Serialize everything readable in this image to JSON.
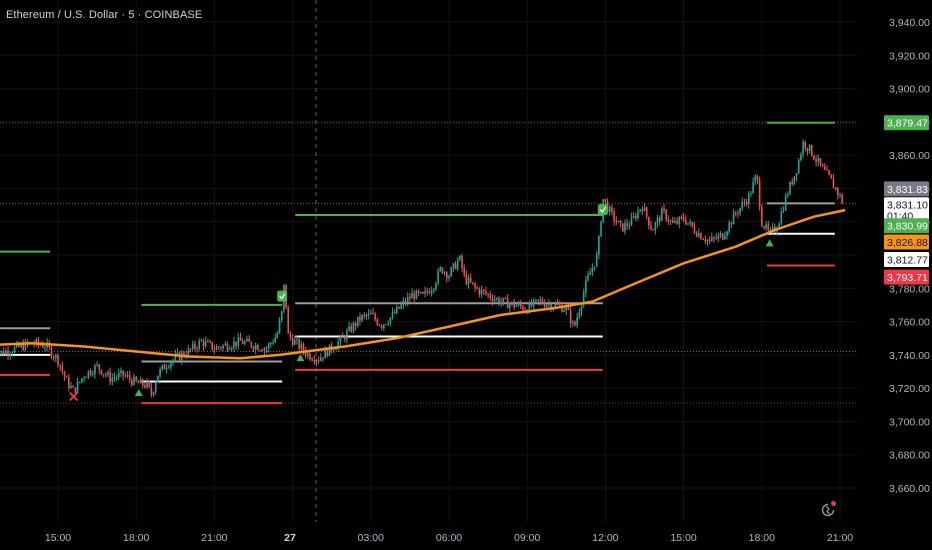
{
  "chart_title": "Ethereum / U.S. Dollar · 5 · COINBASE",
  "colors": {
    "background": "#000000",
    "up": "#26a69a",
    "down": "#ef5350",
    "ema": "#f7931a",
    "green_level": "#4caf50",
    "red_level": "#f23645",
    "white_level": "#ffffff",
    "gray_level": "#9e9e9e",
    "axis_text": "#b2b5be"
  },
  "chart_data": {
    "type": "candlestick",
    "symbol": "ETHUSD",
    "interval": "5",
    "exchange": "COINBASE",
    "y_range": [
      3650,
      3950
    ],
    "y_ticks": [
      "3,940.00",
      "3,920.00",
      "3,900.00",
      "3,880.00",
      "3,860.00",
      "3,840.00",
      "3,820.00",
      "3,800.00",
      "3,780.00",
      "3,760.00",
      "3,740.00",
      "3,720.00",
      "3,700.00",
      "3,680.00",
      "3,660.00"
    ],
    "y_tick_values": [
      3940,
      3920,
      3900,
      3880,
      3860,
      3840,
      3820,
      3800,
      3780,
      3760,
      3740,
      3720,
      3700,
      3680,
      3660
    ],
    "x_range": [
      12.5,
      45.5
    ],
    "x_ticks": [
      {
        "label": "15:00",
        "hour": 15
      },
      {
        "label": "18:00",
        "hour": 18
      },
      {
        "label": "21:00",
        "hour": 21
      },
      {
        "label": "27",
        "hour": 24,
        "bold": true
      },
      {
        "label": "03:00",
        "hour": 27
      },
      {
        "label": "06:00",
        "hour": 30
      },
      {
        "label": "09:00",
        "hour": 33
      },
      {
        "label": "12:00",
        "hour": 36
      },
      {
        "label": "15:00",
        "hour": 39
      },
      {
        "label": "18:00",
        "hour": 42
      },
      {
        "label": "21:00",
        "hour": 45
      }
    ],
    "session_separator_hour": 24,
    "price_path": [
      [
        12.5,
        3740
      ],
      [
        13.2,
        3743
      ],
      [
        14.0,
        3747
      ],
      [
        14.5,
        3746
      ],
      [
        15.0,
        3737
      ],
      [
        15.3,
        3725
      ],
      [
        15.6,
        3718
      ],
      [
        16.0,
        3728
      ],
      [
        16.5,
        3733
      ],
      [
        17.0,
        3726
      ],
      [
        17.5,
        3728
      ],
      [
        18.0,
        3723
      ],
      [
        18.4,
        3722
      ],
      [
        18.6,
        3716
      ],
      [
        18.8,
        3728
      ],
      [
        19.2,
        3735
      ],
      [
        19.6,
        3739
      ],
      [
        20.0,
        3742
      ],
      [
        20.5,
        3748
      ],
      [
        21.0,
        3744
      ],
      [
        21.5,
        3746
      ],
      [
        22.0,
        3748
      ],
      [
        22.5,
        3746
      ],
      [
        23.0,
        3744
      ],
      [
        23.4,
        3752
      ],
      [
        23.6,
        3766
      ],
      [
        23.7,
        3788
      ],
      [
        23.8,
        3752
      ],
      [
        24.2,
        3746
      ],
      [
        24.6,
        3740
      ],
      [
        25.0,
        3738
      ],
      [
        25.4,
        3743
      ],
      [
        25.8,
        3748
      ],
      [
        26.2,
        3755
      ],
      [
        26.6,
        3762
      ],
      [
        27.0,
        3764
      ],
      [
        27.4,
        3758
      ],
      [
        27.8,
        3763
      ],
      [
        28.2,
        3770
      ],
      [
        28.6,
        3776
      ],
      [
        29.0,
        3775
      ],
      [
        29.4,
        3782
      ],
      [
        29.7,
        3792
      ],
      [
        30.0,
        3788
      ],
      [
        30.4,
        3798
      ],
      [
        30.6,
        3786
      ],
      [
        31.0,
        3780
      ],
      [
        31.5,
        3776
      ],
      [
        32.0,
        3772
      ],
      [
        32.5,
        3770
      ],
      [
        33.0,
        3768
      ],
      [
        33.5,
        3772
      ],
      [
        34.0,
        3770
      ],
      [
        34.5,
        3768
      ],
      [
        34.8,
        3756
      ],
      [
        35.0,
        3768
      ],
      [
        35.3,
        3785
      ],
      [
        35.7,
        3800
      ],
      [
        35.9,
        3834
      ],
      [
        36.2,
        3825
      ],
      [
        36.6,
        3816
      ],
      [
        37.0,
        3820
      ],
      [
        37.4,
        3830
      ],
      [
        37.8,
        3815
      ],
      [
        38.2,
        3826
      ],
      [
        38.6,
        3818
      ],
      [
        39.0,
        3822
      ],
      [
        39.5,
        3814
      ],
      [
        40.0,
        3808
      ],
      [
        40.5,
        3812
      ],
      [
        41.0,
        3825
      ],
      [
        41.5,
        3835
      ],
      [
        41.8,
        3848
      ],
      [
        42.0,
        3820
      ],
      [
        42.3,
        3812
      ],
      [
        42.6,
        3818
      ],
      [
        43.0,
        3838
      ],
      [
        43.3,
        3850
      ],
      [
        43.6,
        3868
      ],
      [
        43.9,
        3862
      ],
      [
        44.3,
        3852
      ],
      [
        44.6,
        3846
      ],
      [
        44.9,
        3838
      ],
      [
        45.1,
        3832
      ]
    ],
    "ema_path": [
      [
        12.5,
        3746
      ],
      [
        14.0,
        3747
      ],
      [
        16.0,
        3745
      ],
      [
        18.0,
        3742
      ],
      [
        20.0,
        3739
      ],
      [
        22.0,
        3738
      ],
      [
        23.5,
        3740
      ],
      [
        24.5,
        3742
      ],
      [
        26.0,
        3745
      ],
      [
        28.0,
        3750
      ],
      [
        30.0,
        3757
      ],
      [
        32.0,
        3764
      ],
      [
        34.0,
        3768
      ],
      [
        35.5,
        3772
      ],
      [
        37.0,
        3782
      ],
      [
        39.0,
        3795
      ],
      [
        41.0,
        3805
      ],
      [
        42.5,
        3815
      ],
      [
        44.0,
        3823
      ],
      [
        45.2,
        3827
      ]
    ],
    "level_lines": [
      {
        "color": "green",
        "value": 3802,
        "x0": 12.5,
        "x1": 14.7
      },
      {
        "color": "gray",
        "value": 3756,
        "x0": 12.5,
        "x1": 14.7
      },
      {
        "color": "white",
        "value": 3740,
        "x0": 12.5,
        "x1": 14.7
      },
      {
        "color": "red",
        "value": 3728,
        "x0": 12.5,
        "x1": 14.7
      },
      {
        "color": "green",
        "value": 3770,
        "x0": 18.2,
        "x1": 23.6
      },
      {
        "color": "gray",
        "value": 3736,
        "x0": 18.2,
        "x1": 23.6
      },
      {
        "color": "white",
        "value": 3724,
        "x0": 18.2,
        "x1": 23.6
      },
      {
        "color": "red",
        "value": 3711,
        "x0": 18.2,
        "x1": 23.6
      },
      {
        "color": "green",
        "value": 3824,
        "x0": 24.1,
        "x1": 35.9
      },
      {
        "color": "gray",
        "value": 3771,
        "x0": 24.1,
        "x1": 35.9
      },
      {
        "color": "white",
        "value": 3751,
        "x0": 24.1,
        "x1": 35.9
      },
      {
        "color": "red",
        "value": 3731,
        "x0": 24.1,
        "x1": 35.9
      },
      {
        "color": "green",
        "value": 3879.47,
        "x0": 42.2,
        "x1": 44.8
      },
      {
        "color": "gray",
        "value": 3831,
        "x0": 42.2,
        "x1": 44.8
      },
      {
        "color": "white",
        "value": 3812.77,
        "x0": 42.2,
        "x1": 44.8
      },
      {
        "color": "red",
        "value": 3793.71,
        "x0": 42.2,
        "x1": 44.8
      }
    ],
    "dotted_lines": [
      {
        "value": 3879.47,
        "color": "green"
      },
      {
        "value": 3831.1,
        "color": "red"
      },
      {
        "value": 3742.0,
        "color": "white"
      },
      {
        "value": 3711.0,
        "color": "gray"
      }
    ],
    "markers": [
      {
        "type": "up_triangle",
        "hour": 12.6,
        "value": 3733
      },
      {
        "type": "x_mark",
        "hour": 15.6,
        "value": 3715
      },
      {
        "type": "up_triangle",
        "hour": 18.1,
        "value": 3717
      },
      {
        "type": "check_badge",
        "hour": 23.6,
        "value": 3775
      },
      {
        "type": "up_triangle",
        "hour": 24.3,
        "value": 3738
      },
      {
        "type": "check_badge",
        "hour": 35.9,
        "value": 3827
      },
      {
        "type": "up_triangle",
        "hour": 42.3,
        "value": 3807
      }
    ],
    "price_labels": [
      {
        "text": "3,879.47",
        "value": 3879.47,
        "bg": "#4caf50",
        "fg": "#ffffff"
      },
      {
        "text": "3,831.83",
        "value": 3839.7,
        "bg": "#787b86",
        "fg": "#ffffff"
      },
      {
        "text": "3,831.10",
        "value": 3830.2,
        "bg": "#ffffff",
        "fg": "#131722",
        "sub": "01:40"
      },
      {
        "text": "3,830.99",
        "value": 3817.6,
        "bg": "#4caf50",
        "fg": "#ffffff"
      },
      {
        "text": "3,826.88",
        "value": 3807.8,
        "bg": "#f7931a",
        "fg": "#131722"
      },
      {
        "text": "3,812.77",
        "value": 3797.3,
        "bg": "#ffffff",
        "fg": "#131722"
      },
      {
        "text": "3,793.71",
        "value": 3786.7,
        "bg": "#f23645",
        "fg": "#ffffff"
      }
    ]
  }
}
